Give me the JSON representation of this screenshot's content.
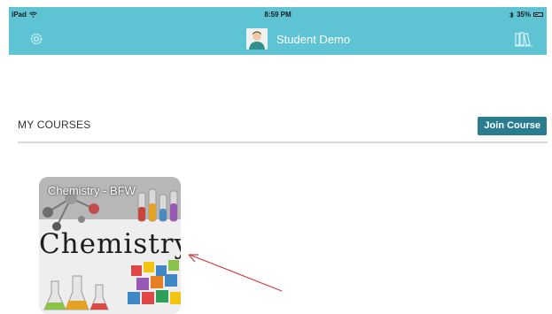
{
  "status_bar": {
    "device": "iPad",
    "time": "8:59 PM",
    "battery": "35%"
  },
  "nav": {
    "user_name": "Student Demo",
    "left_icon": "gear-icon",
    "right_icon": "library-icon"
  },
  "courses": {
    "header": "MY COURSES",
    "join_button": "Join Course",
    "items": [
      {
        "title": "Chemistry - BFW",
        "cover_text": "Chemistry"
      }
    ]
  },
  "colors": {
    "nav": "#5ec4d4",
    "button": "#2a7d8f",
    "arrow": "#d63a3a"
  }
}
